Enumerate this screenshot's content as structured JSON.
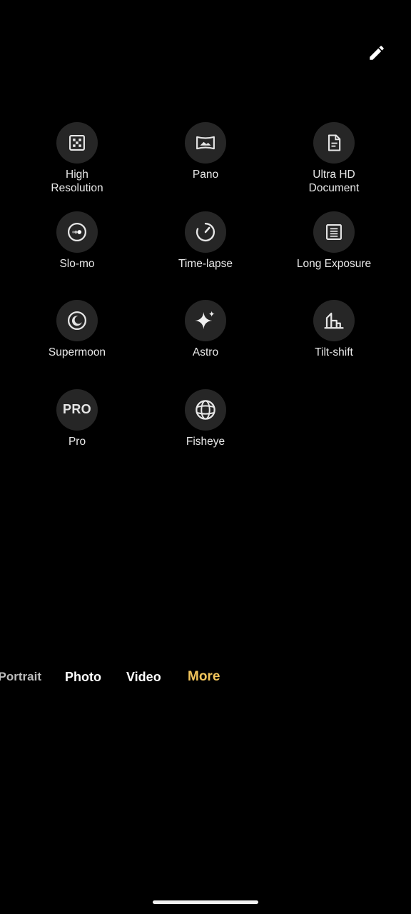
{
  "header": {
    "edit_icon": "pencil-icon"
  },
  "modes": [
    {
      "id": "high-resolution",
      "label": "High\nResolution",
      "icon": "high-resolution-icon"
    },
    {
      "id": "pano",
      "label": "Pano",
      "icon": "panorama-icon"
    },
    {
      "id": "ultra-hd-document",
      "label": "Ultra HD\nDocument",
      "icon": "document-icon"
    },
    {
      "id": "slo-mo",
      "label": "Slo-mo",
      "icon": "slow-motion-icon"
    },
    {
      "id": "time-lapse",
      "label": "Time-lapse",
      "icon": "time-lapse-icon"
    },
    {
      "id": "long-exposure",
      "label": "Long Exposure",
      "icon": "long-exposure-icon"
    },
    {
      "id": "supermoon",
      "label": "Supermoon",
      "icon": "moon-icon"
    },
    {
      "id": "astro",
      "label": "Astro",
      "icon": "sparkle-icon"
    },
    {
      "id": "tilt-shift",
      "label": "Tilt-shift",
      "icon": "buildings-icon"
    },
    {
      "id": "pro",
      "label": "Pro",
      "icon": "pro-icon",
      "icon_text": "PRO"
    },
    {
      "id": "fisheye",
      "label": "Fisheye",
      "icon": "globe-icon"
    }
  ],
  "tabs": [
    {
      "id": "portrait",
      "label": "Portrait"
    },
    {
      "id": "photo",
      "label": "Photo"
    },
    {
      "id": "video",
      "label": "Video"
    },
    {
      "id": "more",
      "label": "More",
      "active": true
    }
  ],
  "colors": {
    "background": "#000000",
    "icon_circle": "#262626",
    "active_tab": "#f2c55c",
    "text": "#ffffff"
  }
}
